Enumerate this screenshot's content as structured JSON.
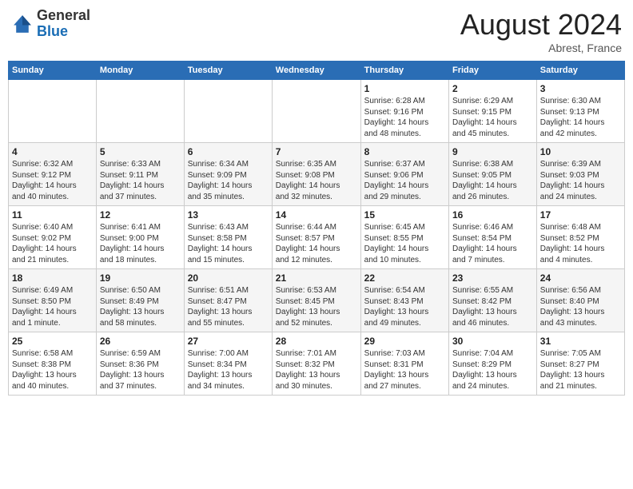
{
  "header": {
    "logo_general": "General",
    "logo_blue": "Blue",
    "month_year": "August 2024",
    "location": "Abrest, France"
  },
  "days_of_week": [
    "Sunday",
    "Monday",
    "Tuesday",
    "Wednesday",
    "Thursday",
    "Friday",
    "Saturday"
  ],
  "weeks": [
    [
      {
        "day": "",
        "info": ""
      },
      {
        "day": "",
        "info": ""
      },
      {
        "day": "",
        "info": ""
      },
      {
        "day": "",
        "info": ""
      },
      {
        "day": "1",
        "info": "Sunrise: 6:28 AM\nSunset: 9:16 PM\nDaylight: 14 hours\nand 48 minutes."
      },
      {
        "day": "2",
        "info": "Sunrise: 6:29 AM\nSunset: 9:15 PM\nDaylight: 14 hours\nand 45 minutes."
      },
      {
        "day": "3",
        "info": "Sunrise: 6:30 AM\nSunset: 9:13 PM\nDaylight: 14 hours\nand 42 minutes."
      }
    ],
    [
      {
        "day": "4",
        "info": "Sunrise: 6:32 AM\nSunset: 9:12 PM\nDaylight: 14 hours\nand 40 minutes."
      },
      {
        "day": "5",
        "info": "Sunrise: 6:33 AM\nSunset: 9:11 PM\nDaylight: 14 hours\nand 37 minutes."
      },
      {
        "day": "6",
        "info": "Sunrise: 6:34 AM\nSunset: 9:09 PM\nDaylight: 14 hours\nand 35 minutes."
      },
      {
        "day": "7",
        "info": "Sunrise: 6:35 AM\nSunset: 9:08 PM\nDaylight: 14 hours\nand 32 minutes."
      },
      {
        "day": "8",
        "info": "Sunrise: 6:37 AM\nSunset: 9:06 PM\nDaylight: 14 hours\nand 29 minutes."
      },
      {
        "day": "9",
        "info": "Sunrise: 6:38 AM\nSunset: 9:05 PM\nDaylight: 14 hours\nand 26 minutes."
      },
      {
        "day": "10",
        "info": "Sunrise: 6:39 AM\nSunset: 9:03 PM\nDaylight: 14 hours\nand 24 minutes."
      }
    ],
    [
      {
        "day": "11",
        "info": "Sunrise: 6:40 AM\nSunset: 9:02 PM\nDaylight: 14 hours\nand 21 minutes."
      },
      {
        "day": "12",
        "info": "Sunrise: 6:41 AM\nSunset: 9:00 PM\nDaylight: 14 hours\nand 18 minutes."
      },
      {
        "day": "13",
        "info": "Sunrise: 6:43 AM\nSunset: 8:58 PM\nDaylight: 14 hours\nand 15 minutes."
      },
      {
        "day": "14",
        "info": "Sunrise: 6:44 AM\nSunset: 8:57 PM\nDaylight: 14 hours\nand 12 minutes."
      },
      {
        "day": "15",
        "info": "Sunrise: 6:45 AM\nSunset: 8:55 PM\nDaylight: 14 hours\nand 10 minutes."
      },
      {
        "day": "16",
        "info": "Sunrise: 6:46 AM\nSunset: 8:54 PM\nDaylight: 14 hours\nand 7 minutes."
      },
      {
        "day": "17",
        "info": "Sunrise: 6:48 AM\nSunset: 8:52 PM\nDaylight: 14 hours\nand 4 minutes."
      }
    ],
    [
      {
        "day": "18",
        "info": "Sunrise: 6:49 AM\nSunset: 8:50 PM\nDaylight: 14 hours\nand 1 minute."
      },
      {
        "day": "19",
        "info": "Sunrise: 6:50 AM\nSunset: 8:49 PM\nDaylight: 13 hours\nand 58 minutes."
      },
      {
        "day": "20",
        "info": "Sunrise: 6:51 AM\nSunset: 8:47 PM\nDaylight: 13 hours\nand 55 minutes."
      },
      {
        "day": "21",
        "info": "Sunrise: 6:53 AM\nSunset: 8:45 PM\nDaylight: 13 hours\nand 52 minutes."
      },
      {
        "day": "22",
        "info": "Sunrise: 6:54 AM\nSunset: 8:43 PM\nDaylight: 13 hours\nand 49 minutes."
      },
      {
        "day": "23",
        "info": "Sunrise: 6:55 AM\nSunset: 8:42 PM\nDaylight: 13 hours\nand 46 minutes."
      },
      {
        "day": "24",
        "info": "Sunrise: 6:56 AM\nSunset: 8:40 PM\nDaylight: 13 hours\nand 43 minutes."
      }
    ],
    [
      {
        "day": "25",
        "info": "Sunrise: 6:58 AM\nSunset: 8:38 PM\nDaylight: 13 hours\nand 40 minutes."
      },
      {
        "day": "26",
        "info": "Sunrise: 6:59 AM\nSunset: 8:36 PM\nDaylight: 13 hours\nand 37 minutes."
      },
      {
        "day": "27",
        "info": "Sunrise: 7:00 AM\nSunset: 8:34 PM\nDaylight: 13 hours\nand 34 minutes."
      },
      {
        "day": "28",
        "info": "Sunrise: 7:01 AM\nSunset: 8:32 PM\nDaylight: 13 hours\nand 30 minutes."
      },
      {
        "day": "29",
        "info": "Sunrise: 7:03 AM\nSunset: 8:31 PM\nDaylight: 13 hours\nand 27 minutes."
      },
      {
        "day": "30",
        "info": "Sunrise: 7:04 AM\nSunset: 8:29 PM\nDaylight: 13 hours\nand 24 minutes."
      },
      {
        "day": "31",
        "info": "Sunrise: 7:05 AM\nSunset: 8:27 PM\nDaylight: 13 hours\nand 21 minutes."
      }
    ]
  ]
}
